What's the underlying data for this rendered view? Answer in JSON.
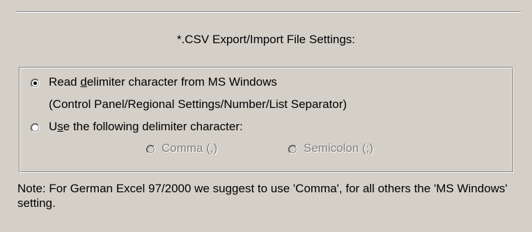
{
  "title": "*.CSV Export/Import File Settings:",
  "option_windows": {
    "label_pre": "Read ",
    "label_mnemonic": "d",
    "label_post": "elimiter character from MS Windows",
    "sublabel": "(Control Panel/Regional Settings/Number/List Separator)",
    "selected": true
  },
  "option_custom": {
    "label_pre": "U",
    "label_mnemonic": "s",
    "label_post": "e the following delimiter character:",
    "selected": false
  },
  "delimiters": {
    "comma_label": "Comma (,)",
    "semicolon_label": "Semicolon (;)"
  },
  "note": "Note: For German Excel 97/2000 we suggest to use 'Comma', for all others the 'MS Windows' setting."
}
